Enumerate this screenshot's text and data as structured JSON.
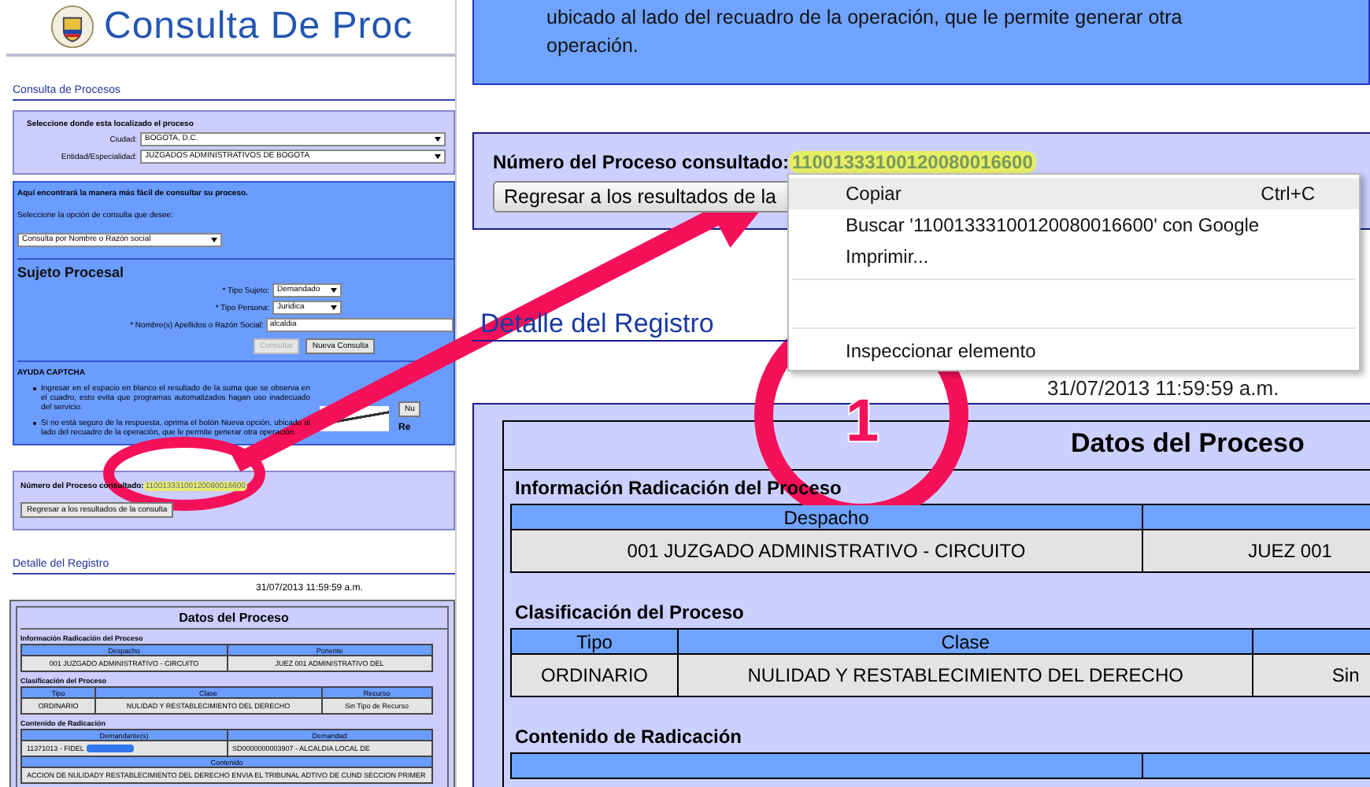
{
  "overview": {
    "site_title": "Consulta De Proc",
    "section_title": "Consulta de Procesos",
    "location_panel": {
      "heading": "Seleccione donde esta localizado el proceso",
      "fields": [
        {
          "label": "Ciudad:",
          "value": "BOGOTA, D.C."
        },
        {
          "label": "Entidad/Especialidad:",
          "value": "JUZGADOS ADMINISTRATIVOS DE BOGOTA"
        }
      ]
    },
    "search_panel": {
      "intro": "Aquí encontrará la manera más fácil de consultar su proceso.",
      "option_label": "Seleccione la opción de consulta que desee:",
      "option_value": "Consulta por Nombre o Razón social",
      "subject_title": "Sujeto Procesal",
      "fields": [
        {
          "kind": "select",
          "label": "* Tipo Sujeto:",
          "value": "Demandado"
        },
        {
          "kind": "select",
          "label": "* Tipo Persona:",
          "value": "Juridica"
        },
        {
          "kind": "text",
          "label": "* Nombre(s) Apellidos o Razón Social:",
          "value": "alcaldia"
        }
      ],
      "buttons": [
        {
          "label": "Consultar",
          "disabled": true
        },
        {
          "label": "Nueva Consulta",
          "disabled": false
        }
      ],
      "captcha_title": "AYUDA CAPTCHA",
      "captcha_help": [
        "Ingresar en el espacio en blanco el resultado de la suma que se observa en el cuadro, esto evita que programas automatizados hagan uso inadecuado del servicio.",
        "Si no está seguro de la respuesta, oprima el botón Nueva opción, ubicado al lado del recuadro de la operación, que le permite generar otra operación."
      ],
      "captcha_button": "Nu",
      "captcha_side_text": "Re"
    },
    "process_number_label": "Número del Proceso consultado:",
    "process_number": "11001333100120080016600",
    "back_button": "Regresar a los resultados de la consulta",
    "detail_title": "Detalle del Registro",
    "timestamp": "31/07/2013 11:59:59 a.m.",
    "data_title": "Datos del Proceso",
    "sections": [
      {
        "title": "Información Radicación del Proceso",
        "columns": [
          "Despacho",
          "Ponente"
        ],
        "rows": [
          [
            "001 JUZGADO ADMINISTRATIVO - CIRCUITO",
            "JUEZ 001 ADMINISTRATIVO DEL"
          ]
        ]
      },
      {
        "title": "Clasificación del Proceso",
        "columns": [
          "Tipo",
          "Clase",
          "Recurso"
        ],
        "rows": [
          [
            "ORDINARIO",
            "NULIDAD Y RESTABLECIMIENTO DEL DERECHO",
            "Sin Tipo de Recurso"
          ]
        ]
      },
      {
        "title": "Contenido de Radicación",
        "columns": [
          "Demandante(s)",
          "Demandad"
        ],
        "rows": [
          [
            "11371013 - FIDEL",
            "SD0000000003907 - ALCALDIA LOCAL DE"
          ]
        ],
        "content_label": "Contenido",
        "content": "ACCION DE NULIDADY RESTABLECIMIENTO DEL DERECHO ENVIA EL TRIBUNAL ADTIVO DE CUND SECCION PRIMER"
      }
    ]
  },
  "zoomed": {
    "help_text": "ubicado al lado del recuadro de la operación, que le permite generar otra operación.",
    "process_number_label": "Número del Proceso consultado:",
    "process_number": "11001333100120080016600",
    "back_button": "Regresar a los resultados de la",
    "detail_title": "Detalle del Registro",
    "timestamp": "31/07/2013 11:59:59 a.m.",
    "data_title": "Datos del Proceso",
    "sections": [
      {
        "title": "Información Radicación del Proceso",
        "columns": [
          "Despacho"
        ],
        "rows": [
          [
            "001 JUZGADO ADMINISTRATIVO - CIRCUITO",
            "JUEZ 001"
          ]
        ]
      },
      {
        "title": "Clasificación del Proceso",
        "columns": [
          "Tipo",
          "Clase"
        ],
        "rows": [
          [
            "ORDINARIO",
            "NULIDAD Y RESTABLECIMIENTO DEL DERECHO",
            "Sin"
          ]
        ]
      },
      {
        "title": "Contenido de Radicación"
      }
    ]
  },
  "context_menu": [
    {
      "kind": "item",
      "label": "Copiar",
      "shortcut": "Ctrl+C",
      "selected": true
    },
    {
      "kind": "item",
      "label": "Buscar '11001333100120080016600' con Google",
      "selected": false
    },
    {
      "kind": "item",
      "label": "Imprimir...",
      "selected": false
    },
    {
      "kind": "separator"
    },
    {
      "kind": "blank"
    },
    {
      "kind": "separator"
    },
    {
      "kind": "item",
      "label": "Inspeccionar elemento",
      "selected": false
    }
  ],
  "annotation": {
    "callout_number": "1"
  }
}
